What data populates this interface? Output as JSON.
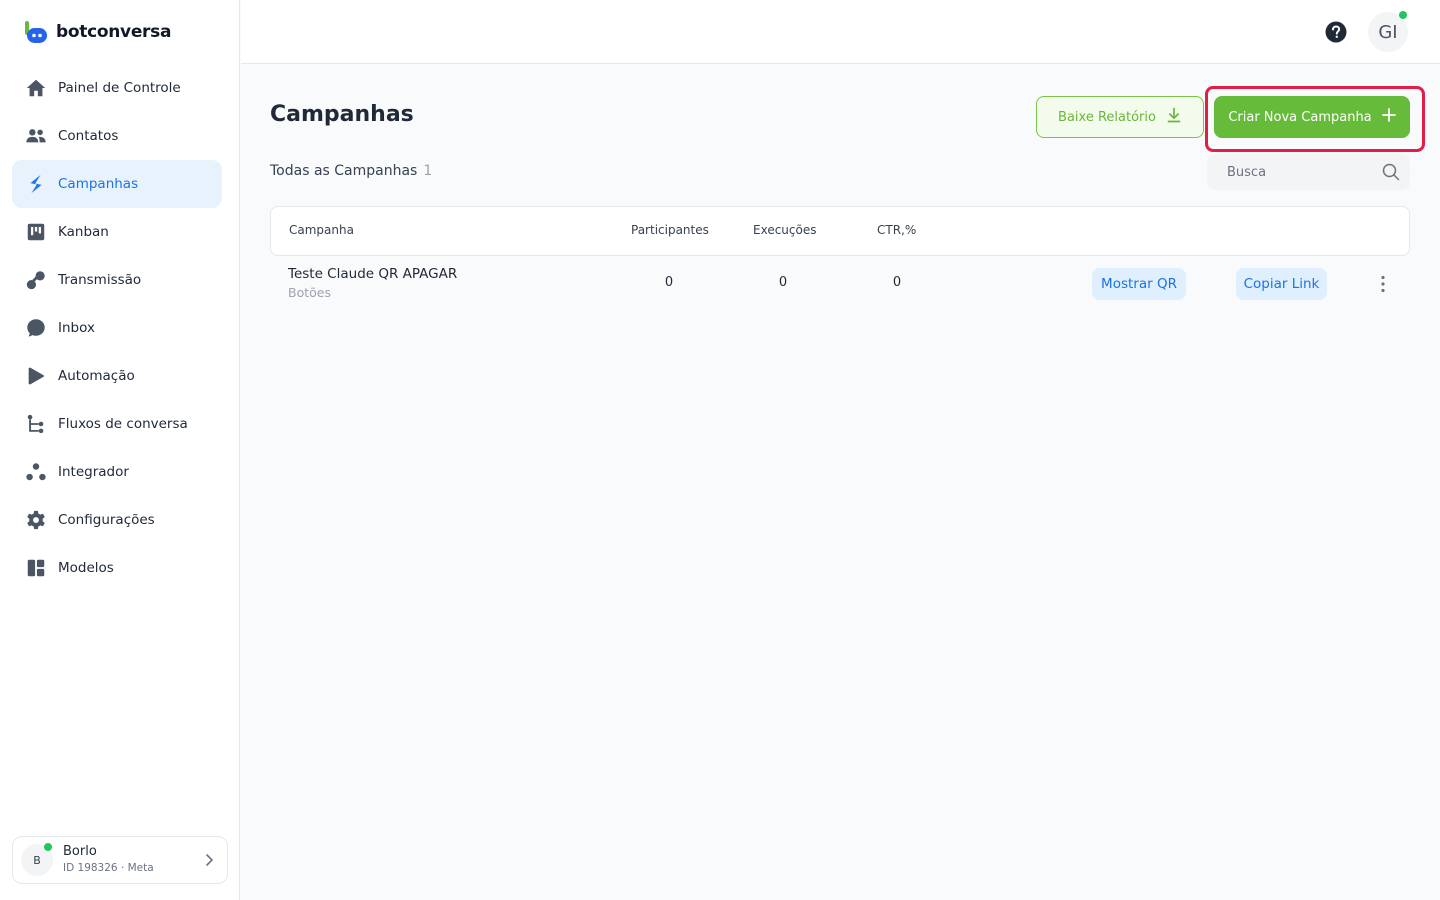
{
  "brand": {
    "name": "botconversa"
  },
  "sidebar": {
    "items": [
      {
        "label": "Painel de Controle",
        "icon": "home-icon"
      },
      {
        "label": "Contatos",
        "icon": "users-icon"
      },
      {
        "label": "Campanhas",
        "icon": "lightning-icon",
        "active": true
      },
      {
        "label": "Kanban",
        "icon": "kanban-icon"
      },
      {
        "label": "Transmissão",
        "icon": "broadcast-icon"
      },
      {
        "label": "Inbox",
        "icon": "chat-bubble-icon"
      },
      {
        "label": "Automação",
        "icon": "automation-icon"
      },
      {
        "label": "Fluxos de conversa",
        "icon": "flow-icon"
      },
      {
        "label": "Integrador",
        "icon": "integrator-icon"
      },
      {
        "label": "Configurações",
        "icon": "gear-icon"
      },
      {
        "label": "Modelos",
        "icon": "templates-icon"
      }
    ],
    "account": {
      "initial": "B",
      "name": "Borlo",
      "id_line": "ID 198326 · Meta"
    }
  },
  "topbar": {
    "user_initials": "GI"
  },
  "main": {
    "title": "Campanhas",
    "report_button": "Baixe Relatório",
    "new_button": "Criar Nova Campanha",
    "subtitle": "Todas as Campanhas",
    "count": "1",
    "search_placeholder": "Busca",
    "columns": [
      "Campanha",
      "Participantes",
      "Execuções",
      "CTR,%"
    ],
    "rows": [
      {
        "name": "Teste Claude QR APAGAR",
        "type": "Botões",
        "participants": "0",
        "executions": "0",
        "ctr": "0",
        "show_qr": "Mostrar QR",
        "copy_link": "Copiar Link"
      }
    ]
  },
  "colors": {
    "accent_blue": "#1a73e8",
    "active_bg": "#e8f2fd",
    "green": "#66bb3a",
    "highlight_red": "#e11d48",
    "online": "#22c55e"
  }
}
